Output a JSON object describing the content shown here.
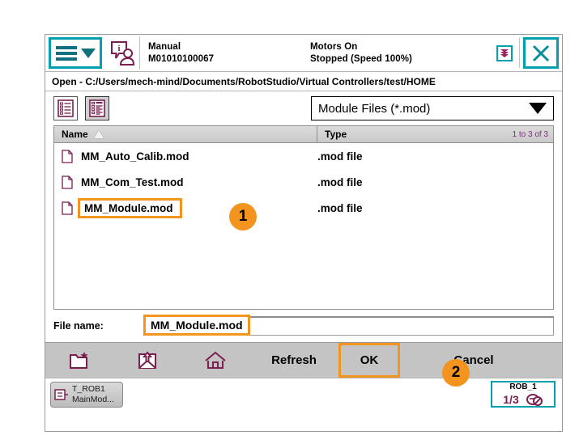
{
  "header": {
    "menu_icon": "hamburger-menu-icon",
    "operator_icon": "operator-info-icon",
    "mode_label": "Manual",
    "controller_id": "M01010100067",
    "motors_status": "Motors On",
    "run_status": "Stopped (Speed 100%)",
    "program_pointer_icon": "program-pointer-icon",
    "close_icon": "close-icon"
  },
  "pathbar": {
    "text": "Open  -  C:/Users/mech-mind/Documents/RobotStudio/Virtual  Controllers/test/HOME"
  },
  "toolbar": {
    "view_list_icon": "list-view-icon",
    "view_detail_icon": "detail-view-icon",
    "filter_value": "Module Files (*.mod)",
    "filter_caret_icon": "chevron-down-icon"
  },
  "filelist": {
    "columns": [
      "Name",
      "Type"
    ],
    "sort_icon": "sort-ascending-icon",
    "count_text": "1 to 3 of 3",
    "rows": [
      {
        "icon": "file-icon",
        "name": "MM_Auto_Calib.mod",
        "type": ".mod file",
        "highlighted": false
      },
      {
        "icon": "file-icon",
        "name": "MM_Com_Test.mod",
        "type": ".mod file",
        "highlighted": false
      },
      {
        "icon": "file-icon",
        "name": "MM_Module.mod",
        "type": ".mod file",
        "highlighted": true
      }
    ]
  },
  "filename": {
    "label": "File name:",
    "value": "MM_Module.mod",
    "placeholder": ""
  },
  "actions": {
    "new_folder_icon": "new-folder-icon",
    "up_folder_icon": "up-one-level-icon",
    "home_icon": "home-icon",
    "refresh_label": "Refresh",
    "ok_label": "OK",
    "cancel_label": "Cancel"
  },
  "taskbar": {
    "task_icon": "task-program-icon",
    "task_name": "T_ROB1",
    "task_module": "MainMod...",
    "quickset_title": "ROB_1",
    "quickset_fraction": "1/3",
    "quickset_icon": "motion-disabled-icon"
  },
  "badges": [
    {
      "id": "1",
      "target": "file-row-mm-module"
    },
    {
      "id": "2",
      "target": "ok-button"
    }
  ],
  "colors": {
    "accent_teal": "#00a0ae",
    "highlight_orange": "#f2941e",
    "icon_purple": "#7a1f50",
    "toolbar_gray": "#c4c4c4"
  }
}
